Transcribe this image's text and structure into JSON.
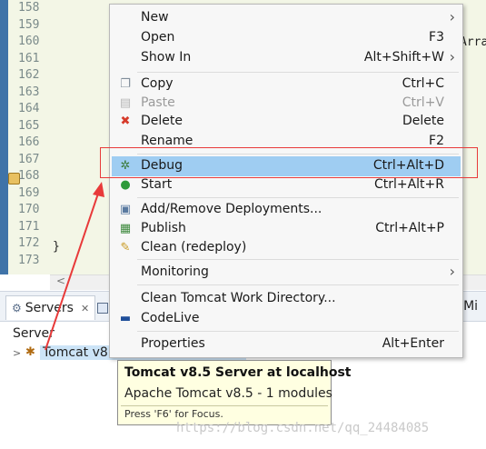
{
  "editor": {
    "line_numbers": [
      "158",
      "159",
      "160",
      "161",
      "162",
      "163",
      "164",
      "165",
      "166",
      "167",
      "168",
      "169",
      "170",
      "171",
      "172",
      "173"
    ],
    "code_fragments": {
      "arra": "Arra",
      "brace": "}"
    }
  },
  "context_menu": {
    "items": [
      {
        "label": "New",
        "accel": "",
        "submenu": true,
        "icon": "",
        "disabled": false
      },
      {
        "label": "Open",
        "accel": "F3",
        "submenu": false,
        "icon": "",
        "disabled": false
      },
      {
        "label": "Show In",
        "accel": "Alt+Shift+W",
        "submenu": true,
        "icon": "",
        "disabled": false
      },
      {
        "label": "Copy",
        "accel": "Ctrl+C",
        "submenu": false,
        "icon": "copy-icon",
        "disabled": false
      },
      {
        "label": "Paste",
        "accel": "Ctrl+V",
        "submenu": false,
        "icon": "paste-icon",
        "disabled": true
      },
      {
        "label": "Delete",
        "accel": "Delete",
        "submenu": false,
        "icon": "delete-icon",
        "disabled": false
      },
      {
        "label": "Rename",
        "accel": "F2",
        "submenu": false,
        "icon": "",
        "disabled": false
      },
      {
        "label": "Debug",
        "accel": "Ctrl+Alt+D",
        "submenu": false,
        "icon": "debug-icon",
        "disabled": false,
        "highlighted": true
      },
      {
        "label": "Start",
        "accel": "Ctrl+Alt+R",
        "submenu": false,
        "icon": "start-icon",
        "disabled": false
      },
      {
        "label": "Add/Remove Deployments...",
        "accel": "",
        "submenu": false,
        "icon": "deployments-icon",
        "disabled": false
      },
      {
        "label": "Publish",
        "accel": "Ctrl+Alt+P",
        "submenu": false,
        "icon": "publish-icon",
        "disabled": false
      },
      {
        "label": "Clean (redeploy)",
        "accel": "",
        "submenu": false,
        "icon": "clean-icon",
        "disabled": false
      },
      {
        "label": "Monitoring",
        "accel": "",
        "submenu": true,
        "icon": "",
        "disabled": false
      },
      {
        "label": "Clean Tomcat Work Directory...",
        "accel": "",
        "submenu": false,
        "icon": "",
        "disabled": false
      },
      {
        "label": "CodeLive",
        "accel": "",
        "submenu": false,
        "icon": "codelive-icon",
        "disabled": false
      },
      {
        "label": "Properties",
        "accel": "Alt+Enter",
        "submenu": false,
        "icon": "",
        "disabled": false
      }
    ]
  },
  "panel": {
    "servers_tab": "Servers",
    "close_glyph": "✕",
    "right_tab_fragment": "e Mi",
    "column_header": "Server",
    "server_row": "Tomcat v8.5 Server at localhost"
  },
  "tooltip": {
    "title": "Tomcat v8.5 Server at localhost",
    "body": "Apache Tomcat v8.5 - 1 modules",
    "focus_hint": "Press 'F6' for Focus."
  },
  "watermark": "https://blog.csdn.net/qq_24484085",
  "colors": {
    "highlight": "#9fcdf2",
    "annotation": "#e83a3a",
    "tooltip_bg": "#ffffe1"
  }
}
